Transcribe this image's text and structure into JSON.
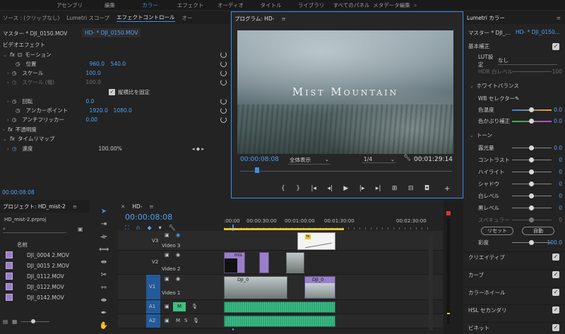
{
  "workspaces": [
    "アセンブリ",
    "編集",
    "カラー",
    "エフェクト",
    "オーディオ",
    "タイトル",
    "ライブラリ",
    "すべてのパネル",
    "メタデータ編集"
  ],
  "workspace_active": "カラー",
  "workspace_more": "»",
  "top_left_tabs": {
    "source": "ソース : (クリップなし)",
    "lumetri_scope": "Lumetri スコープ",
    "effect_controls": "エフェクトコントロール",
    "more": "オー"
  },
  "effect_controls": {
    "master": "マスター * DJI_0150.MOV",
    "clip": "HD- * DJI_0150.MOV",
    "section": "ビデオエフェクト",
    "motion": "モーション",
    "position_label": "位置",
    "position_x": "960.0",
    "position_y": "540.0",
    "scale_label": "スケール",
    "scale_value": "100.0",
    "scale_width_label": "スケール (幅)",
    "scale_width_value": "100.0",
    "uniform_scale": "縦横比を固定",
    "rotation_label": "回転",
    "rotation_value": "0.0",
    "anchor_label": "アンカーポイント",
    "anchor_x": "1920.0",
    "anchor_y": "1080.0",
    "flicker_label": "アンチフリッカー",
    "flicker_value": "0.00",
    "opacity_label": "不透明度",
    "time_remap_label": "タイムリマップ",
    "speed_label": "速度",
    "speed_value": "100.00%",
    "timecode": "00:00:08:08"
  },
  "program": {
    "tab": "プログラム: HD-",
    "menu_icon": "≡",
    "video_title": "Mist Mountain",
    "timecode_in": "00:00:08:08",
    "fit": "全体表示",
    "resolution": "1/4",
    "timecode_out": "00:01:29:14"
  },
  "lumetri": {
    "tab": "Lumetri カラー",
    "master": "マスター * DJI_...",
    "clip": "HD- * DJI_0150...",
    "basic": "基本補正",
    "lut_label": "LUT設定",
    "lut_value": "なし",
    "hdr_label": "HDR 白レベル",
    "hdr_value": "100",
    "wb_section": "ホワイトバランス",
    "wb_selector": "WB セレクター",
    "temp_label": "色温度",
    "temp_value": "0.0",
    "tint_label": "色かぶり補正",
    "tint_value": "0.0",
    "tone_section": "トーン",
    "exposure": "露光量",
    "exposure_value": "0.0",
    "contrast": "コントラスト",
    "contrast_value": "0",
    "highlights": "ハイライト",
    "highlights_value": "0",
    "shadows": "シャドウ",
    "shadows_value": "0",
    "whites": "白レベル",
    "whites_value": "0",
    "blacks": "黒レベル",
    "blacks_value": "0",
    "specular": "スペキュラー",
    "specular_value": "0",
    "reset": "リセット",
    "auto": "自動",
    "saturation": "彩度",
    "saturation_value": "100.0",
    "creative": "クリエイティブ",
    "curves": "カーブ",
    "color_wheels": "カラーホイール",
    "hsl": "HSL セカンダリ",
    "vignette": "ビネット"
  },
  "project": {
    "tab": "プロジェクト: HD_mist-2",
    "file": "HD_mist-2.prproj",
    "col_name": "名前",
    "items": [
      "DJI_0004 2.MOV",
      "DJI_0015 2.MOV",
      "DJI_0112.MOV",
      "DJI_0122.MOV",
      "DJI_0142.MOV"
    ]
  },
  "timeline": {
    "tab": "HD-",
    "timecode": "00:00:08:08",
    "ruler": [
      ":00:00",
      "00:00:30:00",
      "00:01:00:00",
      "00:01:30:00",
      "00:02:30:00"
    ],
    "tracks": [
      {
        "id": "V3",
        "name": "Video 3"
      },
      {
        "id": "V2",
        "name": "Video 2"
      },
      {
        "id": "V1",
        "name": "Video 1"
      },
      {
        "id": "A1",
        "name": ""
      },
      {
        "id": "A2",
        "name": ""
      }
    ],
    "clip_v2": "mis",
    "clip_v1a": "DJI_0",
    "clip_v1b": "DJI_0",
    "m_label": "M",
    "s_label": "S"
  },
  "colors": {
    "accent": "#3b8de8",
    "video_clip": "#9a7ec9",
    "audio_clip": "#2fa775"
  }
}
